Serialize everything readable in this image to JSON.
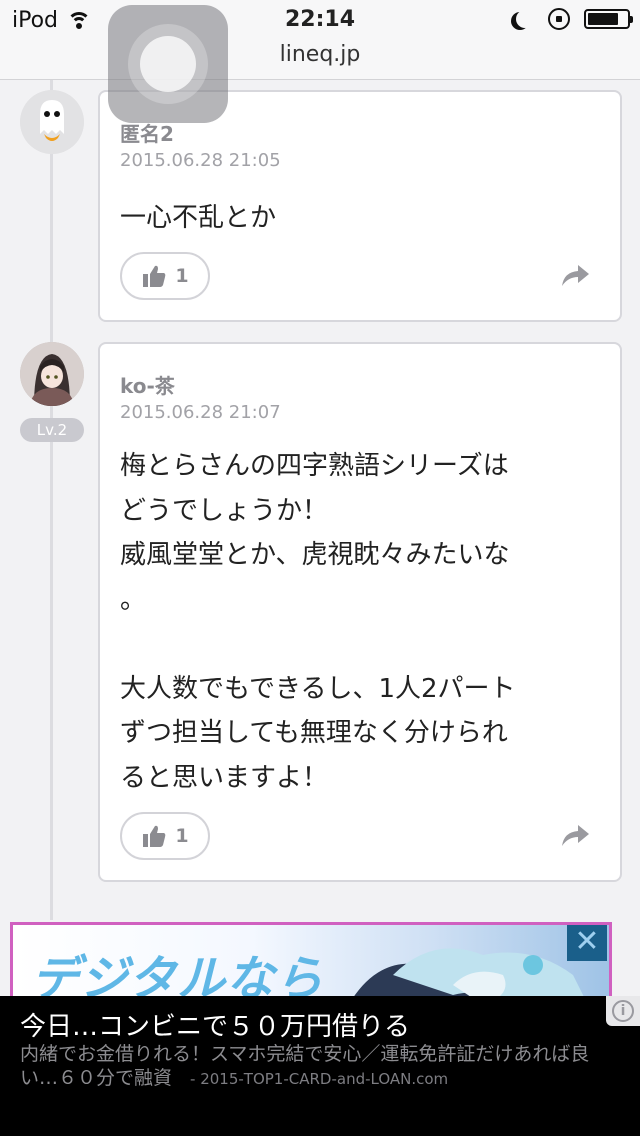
{
  "status_bar": {
    "carrier": "iPod",
    "time": "22:14",
    "url": "lineq.jp"
  },
  "posts": [
    {
      "username": "匿名2",
      "timestamp": "2015.06.28 21:05",
      "body": "一心不乱とか",
      "like_count": "1",
      "avatar_icon": "ghost-avatar-icon"
    },
    {
      "username": "ko-茶",
      "timestamp": "2015.06.28 21:07",
      "level": "Lv.2",
      "body": "梅とらさんの四字熟語シリーズは\nどうでしょうか！\n威風堂堂とか、虎視眈々みたいな\n。\n\n大人数でもできるし、1人2パート\nずつ担当しても無理なく分けられ\nると思いますよ！",
      "like_count": "1",
      "avatar_icon": "user-avatar-icon"
    }
  ],
  "ad_banner": {
    "text": "デジタルなら",
    "close": "✕"
  },
  "bottom_ad": {
    "title": "今日…コンビニで５０万円借りる",
    "description": "内緒でお金借りれる！スマホ完結で安心／運転免許証だけあれば良い…６０分で融資",
    "source": "- 2015-TOP1-CARD-and-LOAN.com"
  },
  "colors": {
    "background": "#f2f2f4",
    "card_border": "#d7d7dc",
    "ad_border": "#d060c0"
  }
}
